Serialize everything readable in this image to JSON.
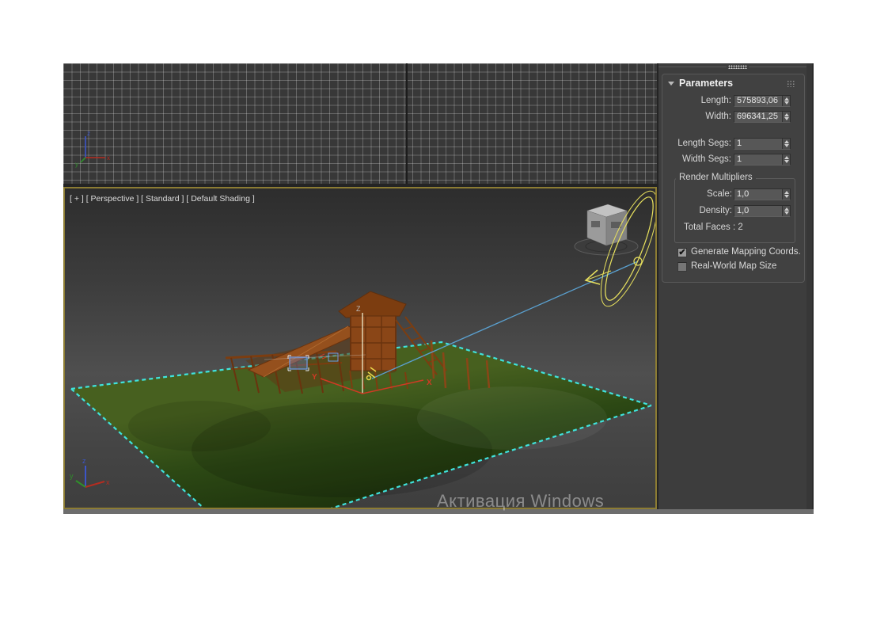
{
  "watermark": "Активация Windows",
  "viewport": {
    "label": "[ + ] [ Perspective ] [ Standard ] [ Default Shading ]",
    "tripod": {
      "x": "x",
      "y": "y",
      "z": "z"
    },
    "gizmo": {
      "x": "X",
      "y": "Y",
      "z": "Z"
    }
  },
  "top_viewport": {
    "tripod": {
      "x": "x",
      "y": "y",
      "z": "z"
    }
  },
  "panel": {
    "rollout_title": "Parameters",
    "fields": {
      "length": {
        "label": "Length:",
        "value": "575893,06"
      },
      "width": {
        "label": "Width:",
        "value": "696341,25"
      },
      "length_segs": {
        "label": "Length Segs:",
        "value": "1"
      },
      "width_segs": {
        "label": "Width Segs:",
        "value": "1"
      }
    },
    "render_multipliers": {
      "title": "Render Multipliers",
      "scale": {
        "label": "Scale:",
        "value": "1,0"
      },
      "density": {
        "label": "Density:",
        "value": "1,0"
      },
      "total_faces": "Total Faces : 2"
    },
    "checkboxes": [
      {
        "label": "Generate Mapping Coords.",
        "checked": true
      },
      {
        "label": "Real-World Map Size",
        "checked": false
      }
    ]
  },
  "icons": {
    "check": "✔"
  },
  "colors": {
    "accent_gold": "#8c7c33",
    "selection_cyan": "#3fe3dc",
    "ray_blue": "#5aa0cf",
    "sun_yellow": "#e8e15e",
    "gizmo_red": "#d03a24",
    "gizmo_yellow": "#ead94c",
    "select_blue": "#6f9ce8"
  }
}
